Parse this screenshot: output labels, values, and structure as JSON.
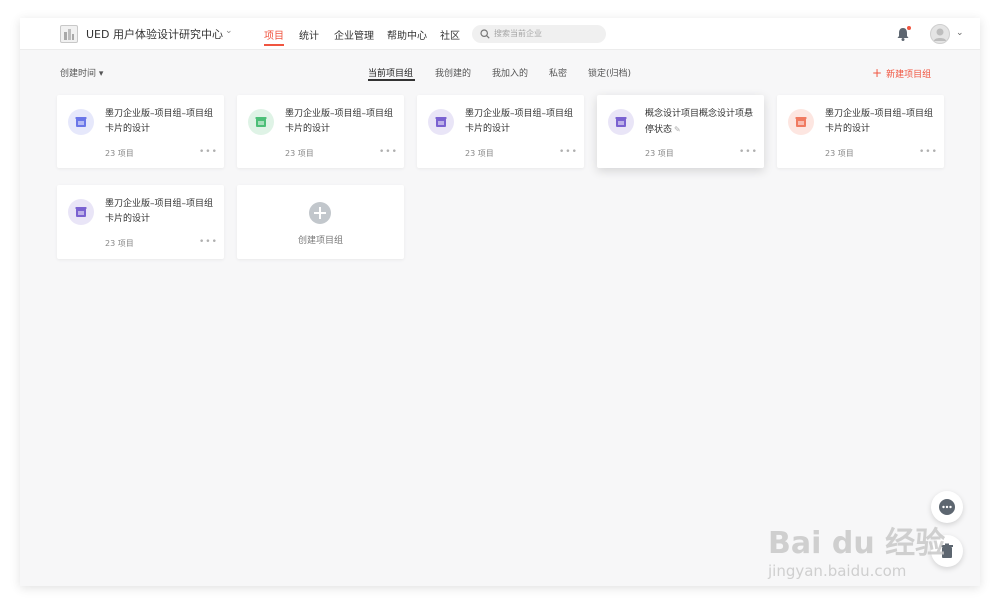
{
  "header": {
    "org_name": "UED 用户体验设计研究中心",
    "org_caret": "⌄",
    "nav": [
      {
        "label": "项目",
        "active": true
      },
      {
        "label": "统计",
        "active": false
      },
      {
        "label": "企业管理",
        "active": false
      },
      {
        "label": "帮助中心",
        "active": false
      },
      {
        "label": "社区",
        "active": false
      }
    ],
    "search_placeholder": "搜索当前企业",
    "notification_icon": "bell-icon",
    "avatar_caret": "⌄"
  },
  "toolbar": {
    "sort_label": "创建时间 ▾",
    "tabs": [
      {
        "label": "当前项目组",
        "active": true
      },
      {
        "label": "我创建的",
        "active": false
      },
      {
        "label": "我加入的",
        "active": false
      },
      {
        "label": "私密",
        "active": false
      },
      {
        "label": "锁定(归档)",
        "active": false
      }
    ],
    "new_group_label": "新建项目组",
    "new_group_icon": "+"
  },
  "cards": [
    {
      "title": "墨刀企业版–项目组–项目组卡片的设计",
      "count": "23 项目",
      "icon_bg": "#e6e8fb",
      "icon_color": "#6a76e8",
      "more": "•••"
    },
    {
      "title": "墨刀企业版–项目组–项目组卡片的设计",
      "count": "23 项目",
      "icon_bg": "#dff3e6",
      "icon_color": "#4cbf77",
      "more": "•••"
    },
    {
      "title": "墨刀企业版–项目组–项目组卡片的设计",
      "count": "23 项目",
      "icon_bg": "#e9e5f7",
      "icon_color": "#7a62d1",
      "more": "•••"
    },
    {
      "title": "概念设计项目概念设计项悬停状态",
      "count": "23 项目",
      "icon_bg": "#e9e5f7",
      "icon_color": "#7a62d1",
      "more": "•••",
      "hovered": true
    },
    {
      "title": "墨刀企业版–项目组–项目组卡片的设计",
      "count": "23 项目",
      "icon_bg": "#fde6e1",
      "icon_color": "#f07a60",
      "more": "•••"
    },
    {
      "title": "墨刀企业版–项目组–项目组卡片的设计",
      "count": "23 项目",
      "icon_bg": "#e9e5f7",
      "icon_color": "#7a62d1",
      "more": "•••"
    }
  ],
  "create_card": {
    "label": "创建项目组"
  },
  "colors": {
    "accent": "#f05540"
  },
  "watermark": {
    "text": "Bai du 经验",
    "url": "jingyan.baidu.com"
  }
}
